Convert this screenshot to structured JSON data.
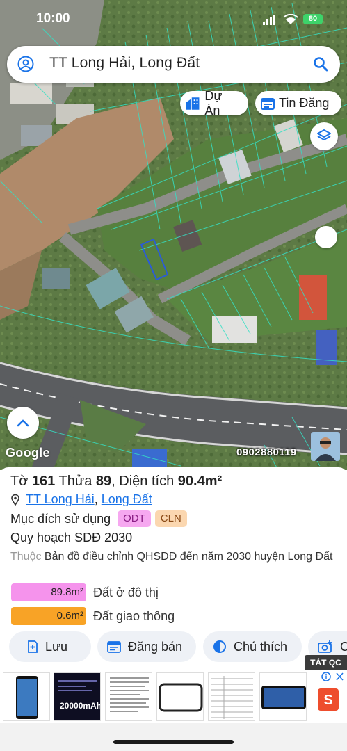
{
  "status": {
    "time": "10:00",
    "battery": "80"
  },
  "search": {
    "query": "TT Long Hải, Long Đất"
  },
  "chips": {
    "projects": "Dự Án",
    "listings": "Tin Đăng"
  },
  "map": {
    "attribution": "Google",
    "phone": "0902880119"
  },
  "parcel": {
    "sheet_label": "Tờ",
    "sheet_no": "161",
    "plot_label": "Thửa",
    "plot_no": "89",
    "area_label": "Diện tích",
    "area": "90.4m²",
    "location": {
      "town": "TT Long Hải",
      "district": "Long Đất",
      "separator": ", "
    },
    "purpose_label": "Mục đích sử dụng",
    "purpose_codes": [
      "ODT",
      "CLN"
    ],
    "plan_title": "Quy hoạch SDĐ 2030",
    "plan_prefix": "Thuộc",
    "plan_source": "Bản đồ điều chỉnh QHSDĐ đến năm 2030 huyện Long Đất",
    "zones": [
      {
        "area": "89.8m²",
        "label": "Đất ở đô thị",
        "color": "#f593ec"
      },
      {
        "area": "0.6m²",
        "label": "Đất giao thông",
        "color": "#f8a326"
      }
    ]
  },
  "actions": {
    "save": "Lưu",
    "sell": "Đăng bán",
    "legend": "Chú thích",
    "capture": "C"
  },
  "ad": {
    "close_label": "TẮT QC",
    "thumb_text": "20000mAh",
    "brand_mark": "S"
  },
  "colors": {
    "accent": "#1a73e8",
    "odt": "#f6a8f0",
    "cln": "#fbd7b0"
  }
}
